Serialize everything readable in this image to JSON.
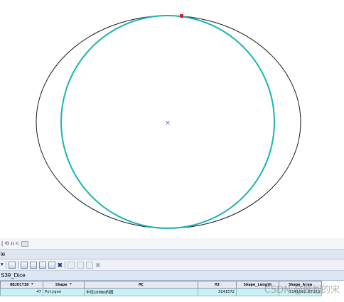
{
  "map": {
    "center_marker": "×",
    "ellipse_color": "#1a1a1a",
    "circle_color": "#19b3b3",
    "vertex_color": "#e02020"
  },
  "table_window": {
    "nav_label": "| ⟲ ıı  <",
    "title": "le",
    "layer_name": "S39_Dice",
    "columns": [
      "OBJECTID *",
      "Shape *",
      "MC",
      "MJ",
      "Shape_Length",
      "Shape_Area"
    ],
    "rows": [
      [
        "47",
        "Polygon",
        "半径1000m的圆",
        "3141572",
        "",
        "3141592.67223"
      ]
    ]
  },
  "watermark": "CSDN @做划的宋"
}
